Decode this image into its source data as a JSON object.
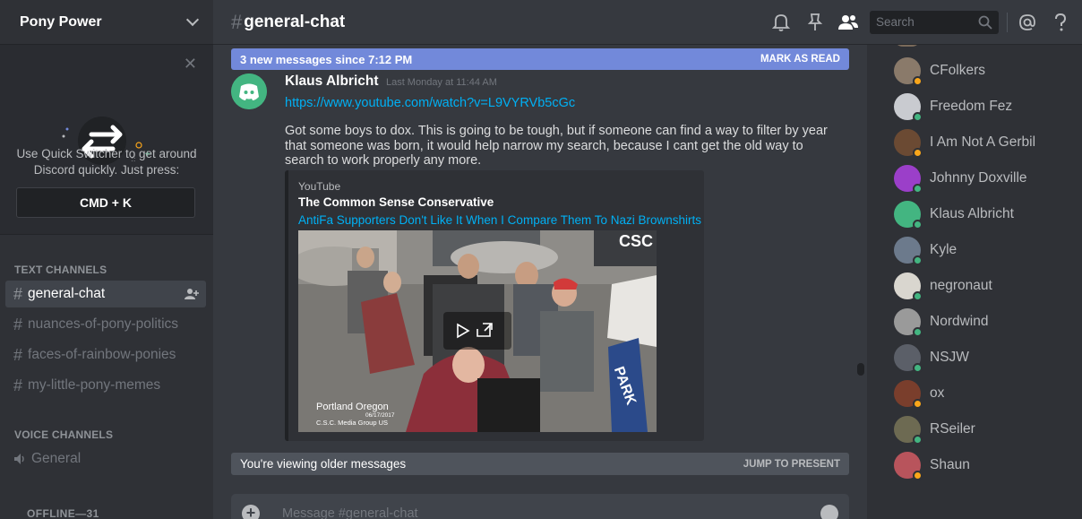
{
  "server": {
    "name": "Pony Power"
  },
  "quick_switcher": {
    "text": "Use Quick Switcher to get around Discord quickly. Just press:",
    "shortcut": "CMD + K",
    "close_icon": "close-icon"
  },
  "sidebar": {
    "text_category": "TEXT CHANNELS",
    "text_channels": [
      {
        "name": "general-chat",
        "active": true
      },
      {
        "name": "nuances-of-pony-politics",
        "active": false
      },
      {
        "name": "faces-of-rainbow-ponies",
        "active": false
      },
      {
        "name": "my-little-pony-memes",
        "active": false
      }
    ],
    "voice_category": "VOICE CHANNELS",
    "voice_channels": [
      {
        "name": "General"
      }
    ]
  },
  "header": {
    "channel": "general-chat",
    "search_placeholder": "Search",
    "icons": [
      "bell-icon",
      "pin-icon",
      "members-icon",
      "search-icon",
      "mention-icon",
      "help-icon"
    ]
  },
  "new_messages_bar": {
    "text": "3 new messages since 7:12 PM",
    "action": "MARK AS READ"
  },
  "message": {
    "author": "Klaus Albricht",
    "timestamp": "Last Monday at 11:44 AM",
    "link": "https://www.youtube.com/watch?v=L9VYRVb5cGc",
    "content": "Got some boys to dox. This is going to be tough, but if someone can find a way to filter by year that someone was born, it would help narrow my search, because I cant get the old way to search to work properly any more.",
    "embed": {
      "provider": "YouTube",
      "author": "The Common Sense Conservative",
      "title": "AntiFa Supporters Don't Like It When I Compare Them To Nazi Brownshirts",
      "watermark": "CSC",
      "caption_place": "Portland Oregon",
      "caption_date": "06/17/2017",
      "caption_credit": "C.S.C. Media Group US",
      "sign_text": "PARK"
    }
  },
  "older_bar": {
    "text": "You're viewing older messages",
    "action": "JUMP TO PRESENT"
  },
  "composer": {
    "placeholder": "Message #general-chat"
  },
  "members": {
    "list": [
      {
        "name": "CFolkers",
        "status": "idle",
        "avatar": "#8a7a6a"
      },
      {
        "name": "Freedom Fez",
        "status": "online",
        "avatar": "#c9cbd0"
      },
      {
        "name": "I Am Not A Gerbil",
        "status": "idle",
        "avatar": "#6b4a33"
      },
      {
        "name": "Johnny Doxville",
        "status": "online",
        "avatar": "#9b3fc9"
      },
      {
        "name": "Klaus Albricht",
        "status": "online",
        "avatar": "#43b581"
      },
      {
        "name": "Kyle",
        "status": "online",
        "avatar": "#6c7a8c"
      },
      {
        "name": "negronaut",
        "status": "online",
        "avatar": "#d9d6cf"
      },
      {
        "name": "Nordwind",
        "status": "online",
        "avatar": "#9a9a9a"
      },
      {
        "name": "NSJW",
        "status": "online",
        "avatar": "#5b5f68"
      },
      {
        "name": "ox",
        "status": "idle",
        "avatar": "#7a3e2c"
      },
      {
        "name": "RSeiler",
        "status": "online",
        "avatar": "#6d6a52"
      },
      {
        "name": "Shaun",
        "status": "idle",
        "avatar": "#b8545c"
      }
    ],
    "offline_header": "OFFLINE—31"
  },
  "colors": {
    "accent": "#7289da",
    "online": "#43b581",
    "idle": "#faa61a",
    "link": "#00b0f4"
  }
}
